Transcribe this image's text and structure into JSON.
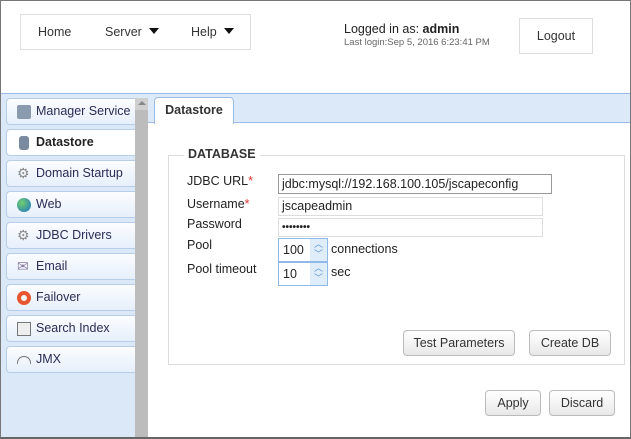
{
  "header": {
    "nav": [
      {
        "label": "Home",
        "dropdown": false
      },
      {
        "label": "Server",
        "dropdown": true
      },
      {
        "label": "Help",
        "dropdown": true
      }
    ],
    "logged_in_prefix": "Logged in as: ",
    "user": "admin",
    "last_login": "Last login:Sep 5, 2016 6:23:41 PM",
    "logout": "Logout"
  },
  "sidebar": {
    "items": [
      {
        "label": "Manager Service",
        "icon": "server-icon"
      },
      {
        "label": "Datastore",
        "icon": "database-icon",
        "selected": true
      },
      {
        "label": "Domain Startup",
        "icon": "gear-play-icon"
      },
      {
        "label": "Web",
        "icon": "globe-icon"
      },
      {
        "label": "JDBC Drivers",
        "icon": "gears-icon"
      },
      {
        "label": "Email",
        "icon": "envelope-icon"
      },
      {
        "label": "Failover",
        "icon": "lifebuoy-icon"
      },
      {
        "label": "Search Index",
        "icon": "search-index-icon"
      },
      {
        "label": "JMX",
        "icon": "gauge-icon"
      }
    ]
  },
  "tab": "Datastore",
  "form": {
    "section": "DATABASE",
    "jdbc_url": {
      "label": "JDBC URL",
      "value": "jdbc:mysql://192.168.100.105/jscapeconfig",
      "required": "*"
    },
    "username": {
      "label": "Username",
      "value": "jscapeadmin",
      "required": "*"
    },
    "password": {
      "label": "Password",
      "value": "••••••••"
    },
    "pool": {
      "label": "Pool",
      "value": "100",
      "unit": "connections"
    },
    "pool_timeout": {
      "label": "Pool timeout",
      "value": "10",
      "unit": "sec"
    },
    "test": "Test Parameters",
    "create": "Create DB"
  },
  "footer": {
    "apply": "Apply",
    "discard": "Discard"
  },
  "colors": {
    "sidebar_bg": "#dbe8f8",
    "tab_border": "#9bbce6",
    "required": "#dd3333"
  }
}
